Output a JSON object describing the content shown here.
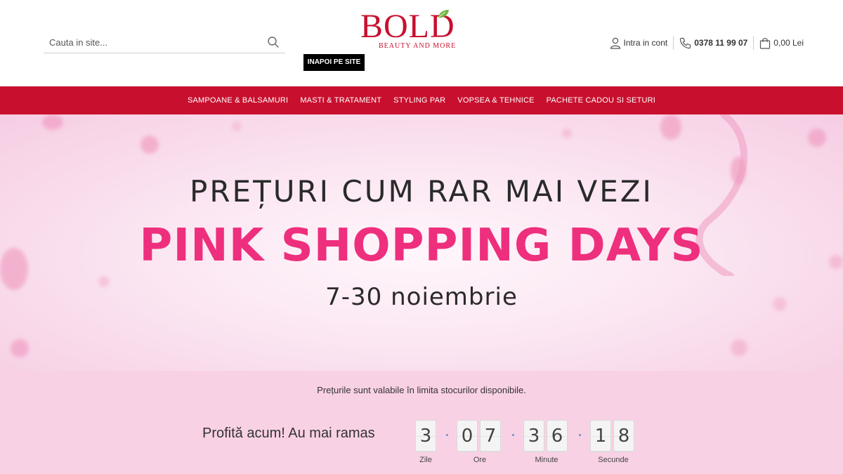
{
  "search": {
    "placeholder": "Cauta in site..."
  },
  "logo": {
    "text": "BOLD",
    "subtitle": "BEAUTY AND MORE"
  },
  "back_button": "INAPOI PE SITE",
  "header_right": {
    "account": "Intra in cont",
    "phone": "0378 11 99 07",
    "cart": "0,00 Lei"
  },
  "nav": {
    "items": [
      "SAMPOANE & BALSAMURI",
      "MASTI & TRATAMENT",
      "STYLING PAR",
      "VOPSEA & TEHNICE",
      "PACHETE CADOU SI SETURI"
    ]
  },
  "hero": {
    "line1": "PREȚURI CUM RAR MAI VEZI",
    "line2": "PINK SHOPPING DAYS",
    "line3": "7-30 noiembrie"
  },
  "promo": {
    "note": "Prețurile sunt valabile în limita stocurilor disponibile.",
    "countdown_label": "Profită acum! Au mai ramas",
    "days": [
      "3"
    ],
    "hours": [
      "0",
      "7"
    ],
    "minutes": [
      "3",
      "6"
    ],
    "seconds": [
      "1",
      "8"
    ],
    "units": {
      "days": "Zile",
      "hours": "Ore",
      "minutes": "Minute",
      "seconds": "Secunde"
    }
  },
  "colors": {
    "brand": "#c8102e",
    "pink_accent": "#ee2f7d",
    "promo_bg": "#f9d1e5"
  },
  "icons": [
    "search-icon",
    "user-icon",
    "phone-icon",
    "cart-icon",
    "leaf-icon"
  ]
}
